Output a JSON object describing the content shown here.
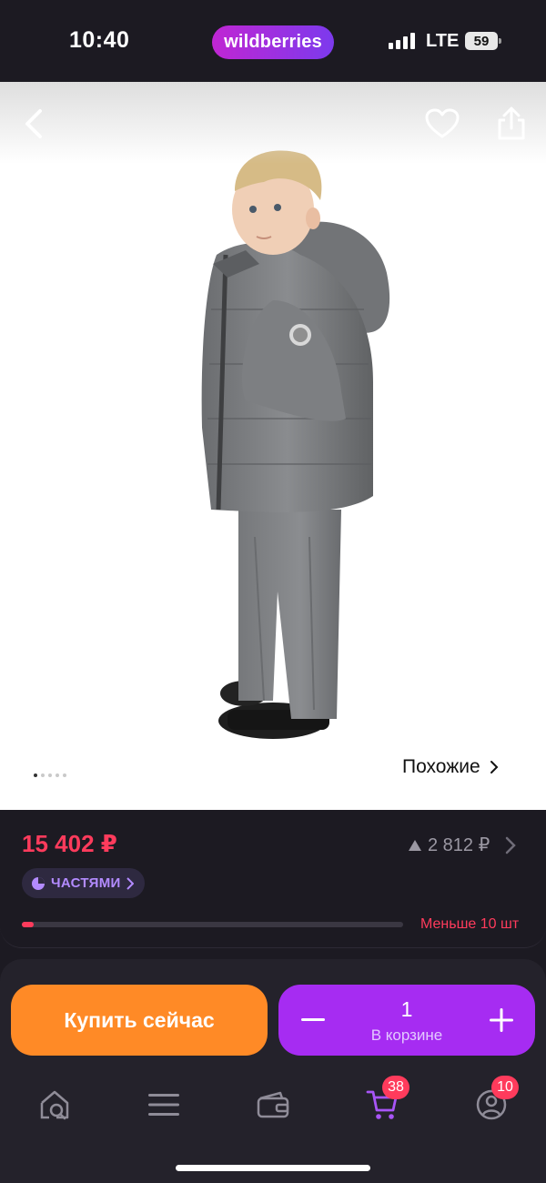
{
  "status": {
    "time": "10:40",
    "brand": "wildberries",
    "network": "LTE",
    "battery": "59"
  },
  "product": {
    "image": {
      "alt": "child in grey winter down suit",
      "slides_total": 5,
      "slide_active": 1
    },
    "nav": {
      "back_icon": "chevron-left-icon",
      "favorite_icon": "heart-icon",
      "share_icon": "share-icon"
    },
    "similar_label": "Похожие"
  },
  "price": {
    "value": "15 402 ₽",
    "delta": "2 812 ₽",
    "installments_label": "ЧАСТЯМИ",
    "stock_label": "Меньше 10 шт",
    "stock_level": 0.03
  },
  "actions": {
    "buy_now": "Купить сейчас",
    "quantity": "1",
    "in_cart": "В корзине"
  },
  "tabbar": {
    "items": [
      {
        "name": "home",
        "icon": "home-search-icon"
      },
      {
        "name": "catalog",
        "icon": "menu-icon"
      },
      {
        "name": "wallet",
        "icon": "wallet-icon"
      },
      {
        "name": "cart",
        "icon": "cart-icon",
        "badge": "38"
      },
      {
        "name": "profile",
        "icon": "profile-icon",
        "badge": "10"
      }
    ]
  },
  "colors": {
    "accent_price": "#ff3b5c",
    "buy_now": "#ff8a26",
    "cart": "#a62cf2",
    "cart_tab": "#a855f7"
  }
}
